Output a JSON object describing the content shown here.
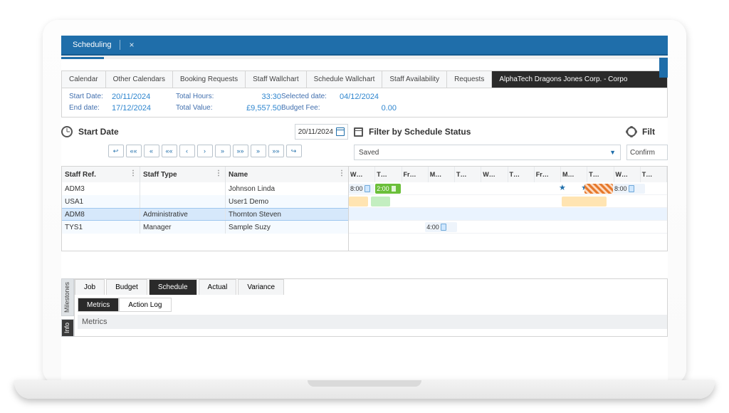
{
  "ribbon": {
    "title": "Scheduling"
  },
  "nav": {
    "tabs": [
      "Calendar",
      "Other Calendars",
      "Booking Requests",
      "Staff Wallchart",
      "Schedule Wallchart",
      "Staff Availability",
      "Requests"
    ],
    "active_job": "AlphaTech Dragons Jones Corp. - Corpo"
  },
  "summary": {
    "start_date_label": "Start Date:",
    "start_date": "20/11/2024",
    "end_date_label": "End date:",
    "end_date": "17/12/2024",
    "total_hours_label": "Total Hours:",
    "total_hours": "33:30",
    "total_value_label": "Total Value:",
    "total_value": "£9,557.50",
    "selected_date_label": "Selected date:",
    "selected_date": "04/12/2024",
    "budget_fee_label": "Budget Fee:",
    "budget_fee": "0.00"
  },
  "startdate_panel": {
    "title": "Start Date",
    "value": "20/11/2024"
  },
  "filter_panel": {
    "title": "Filter by Schedule Status",
    "selected": "Saved"
  },
  "settings_panel": {
    "title": "Filt",
    "confirm": "Confirm"
  },
  "grid": {
    "columns": [
      "Staff Ref.",
      "Staff Type",
      "Name"
    ],
    "days": [
      "W…",
      "T…",
      "Fr…",
      "M…",
      "T…",
      "W…",
      "T…",
      "Fr…",
      "M…",
      "T…",
      "W…",
      "T…"
    ],
    "rows": [
      {
        "ref": "ADM3",
        "type": "",
        "name": "Johnson Linda"
      },
      {
        "ref": "USA1",
        "type": "",
        "name": "User1 Demo"
      },
      {
        "ref": "ADM8",
        "type": "Administrative",
        "name": "Thornton Steven"
      },
      {
        "ref": "TYS1",
        "type": "Manager",
        "name": "Sample Suzy"
      }
    ],
    "chips": {
      "r0_a": "8:00",
      "r0_b": "2:00",
      "r0_c": "8:00",
      "r3_a": "4:00"
    }
  },
  "bottom": {
    "vtabs": [
      "Milestones",
      "Info"
    ],
    "tabs1": [
      "Job",
      "Budget",
      "Schedule",
      "Actual",
      "Variance"
    ],
    "tabs1_active": 2,
    "tabs2": [
      "Metrics",
      "Action Log"
    ],
    "tabs2_active": 0,
    "metrics_title": "Metrics"
  }
}
